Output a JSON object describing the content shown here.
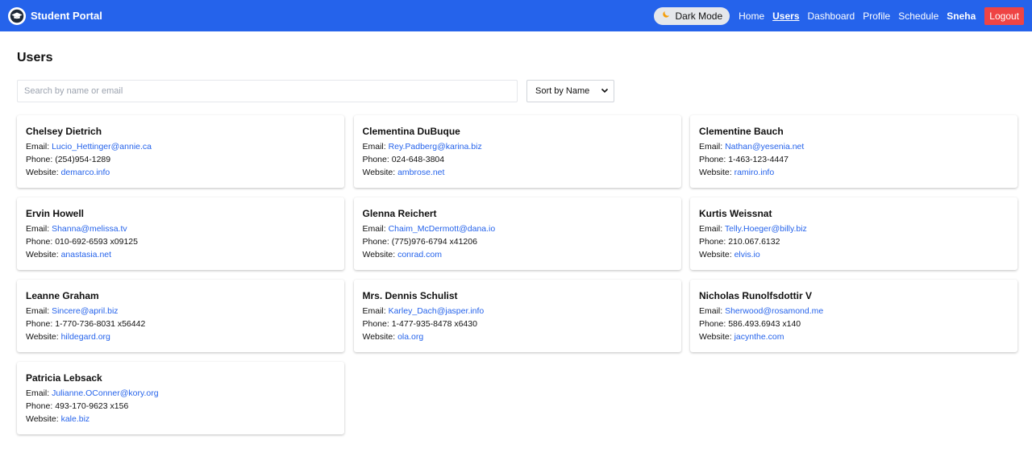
{
  "header": {
    "title": "Student Portal",
    "dark_mode_label": "Dark Mode",
    "nav": [
      {
        "label": "Home",
        "active": false
      },
      {
        "label": "Users",
        "active": true
      },
      {
        "label": "Dashboard",
        "active": false
      },
      {
        "label": "Profile",
        "active": false
      },
      {
        "label": "Schedule",
        "active": false
      }
    ],
    "user": "Sneha",
    "logout_label": "Logout"
  },
  "page": {
    "title": "Users",
    "search_placeholder": "Search by name or email",
    "sort_value": "Sort by Name"
  },
  "labels": {
    "email": "Email: ",
    "phone": "Phone: ",
    "website": "Website: "
  },
  "users": [
    {
      "name": "Chelsey Dietrich",
      "email": "Lucio_Hettinger@annie.ca",
      "phone": "(254)954-1289",
      "website": "demarco.info"
    },
    {
      "name": "Clementina DuBuque",
      "email": "Rey.Padberg@karina.biz",
      "phone": "024-648-3804",
      "website": "ambrose.net"
    },
    {
      "name": "Clementine Bauch",
      "email": "Nathan@yesenia.net",
      "phone": "1-463-123-4447",
      "website": "ramiro.info"
    },
    {
      "name": "Ervin Howell",
      "email": "Shanna@melissa.tv",
      "phone": "010-692-6593 x09125",
      "website": "anastasia.net"
    },
    {
      "name": "Glenna Reichert",
      "email": "Chaim_McDermott@dana.io",
      "phone": "(775)976-6794 x41206",
      "website": "conrad.com"
    },
    {
      "name": "Kurtis Weissnat",
      "email": "Telly.Hoeger@billy.biz",
      "phone": "210.067.6132",
      "website": "elvis.io"
    },
    {
      "name": "Leanne Graham",
      "email": "Sincere@april.biz",
      "phone": "1-770-736-8031 x56442",
      "website": "hildegard.org"
    },
    {
      "name": "Mrs. Dennis Schulist",
      "email": "Karley_Dach@jasper.info",
      "phone": "1-477-935-8478 x6430",
      "website": "ola.org"
    },
    {
      "name": "Nicholas Runolfsdottir V",
      "email": "Sherwood@rosamond.me",
      "phone": "586.493.6943 x140",
      "website": "jacynthe.com"
    },
    {
      "name": "Patricia Lebsack",
      "email": "Julianne.OConner@kory.org",
      "phone": "493-170-9623 x156",
      "website": "kale.biz"
    }
  ]
}
